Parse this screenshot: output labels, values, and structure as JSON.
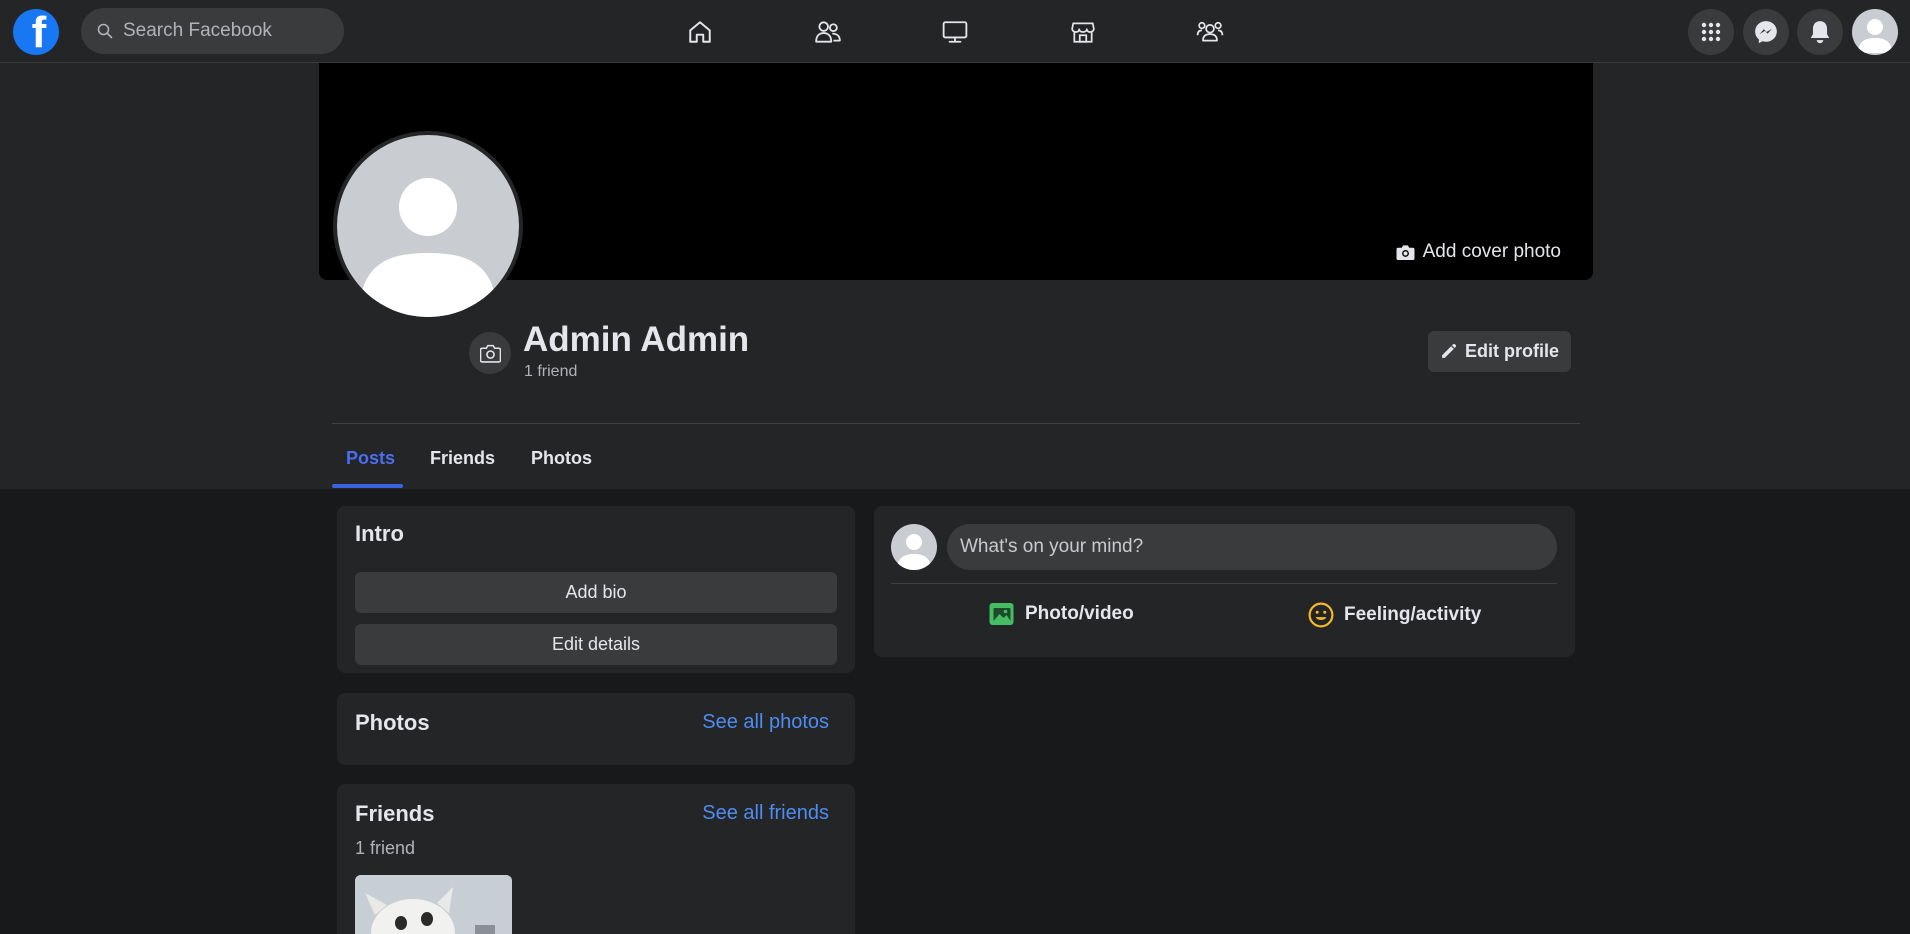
{
  "nav": {
    "logo_text": "f",
    "search_placeholder": "Search Facebook",
    "center_icons": [
      "home-icon",
      "friends-icon",
      "watch-icon",
      "marketplace-icon",
      "groups-icon"
    ],
    "right_icons": [
      "menu-icon",
      "messenger-icon",
      "notifications-icon",
      "account-icon"
    ]
  },
  "profile": {
    "add_cover_label": "Add cover photo",
    "name": "Admin Admin",
    "friend_count": "1 friend",
    "edit_profile_label": "Edit profile"
  },
  "tabs": [
    {
      "label": "Posts",
      "active": true
    },
    {
      "label": "Friends",
      "active": false
    },
    {
      "label": "Photos",
      "active": false
    }
  ],
  "intro": {
    "title": "Intro",
    "add_bio_label": "Add bio",
    "edit_details_label": "Edit details"
  },
  "photos": {
    "title": "Photos",
    "see_all_label": "See all photos"
  },
  "friends": {
    "title": "Friends",
    "see_all_label": "See all friends",
    "count_label": "1 friend"
  },
  "composer": {
    "placeholder": "What's on your mind?",
    "photo_video_label": "Photo/video",
    "feeling_label": "Feeling/activity"
  },
  "colors": {
    "accent": "#1877f2",
    "link": "#4e8cf2",
    "active_tab": "#4b6ef1",
    "photo_green": "#45bd62",
    "feeling_yellow": "#f7b928"
  }
}
